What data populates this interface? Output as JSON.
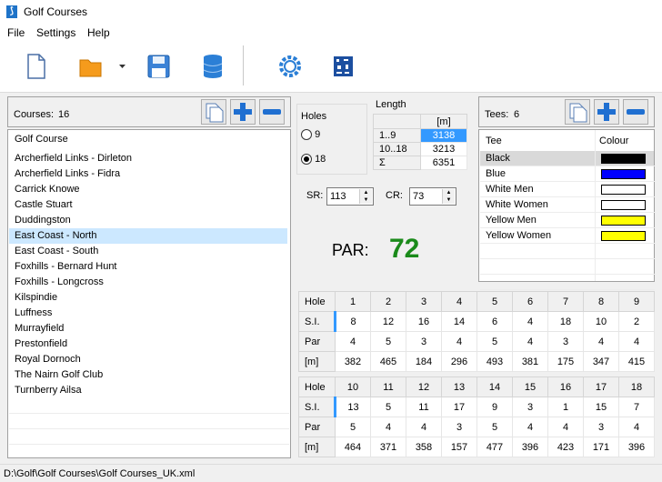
{
  "window": {
    "title": "Golf Courses"
  },
  "menu": [
    "File",
    "Settings",
    "Help"
  ],
  "courses": {
    "label": "Courses:",
    "count": "16",
    "header": "Golf Course",
    "items": [
      "Archerfield Links - Dirleton",
      "Archerfield Links - Fidra",
      "Carrick Knowe",
      "Castle Stuart",
      "Duddingston",
      "East Coast - North",
      "East Coast - South",
      "Foxhills - Bernard Hunt",
      "Foxhills - Longcross",
      "Kilspindie",
      "Luffness",
      "Murrayfield",
      "Prestonfield",
      "Royal Dornoch",
      "The Nairn Golf Club",
      "Turnberry Ailsa"
    ],
    "selected_index": 5
  },
  "holes": {
    "label": "Holes",
    "option9": "9",
    "option18": "18",
    "selected": "18"
  },
  "length": {
    "label": "Length",
    "unit": "[m]",
    "rows": [
      {
        "label": "1..9",
        "value": "3138"
      },
      {
        "label": "10..18",
        "value": "3213"
      },
      {
        "label": "Σ",
        "value": "6351"
      }
    ]
  },
  "sr": {
    "label": "SR:",
    "value": "113"
  },
  "cr": {
    "label": "CR:",
    "value": "73"
  },
  "par": {
    "label": "PAR:",
    "value": "72"
  },
  "tees": {
    "label": "Tees:",
    "count": "6",
    "col_tee": "Tee",
    "col_colour": "Colour",
    "items": [
      {
        "name": "Black",
        "color": "#000000"
      },
      {
        "name": "Blue",
        "color": "#0000ff"
      },
      {
        "name": "White Men",
        "color": "#ffffff"
      },
      {
        "name": "White Women",
        "color": "#ffffff"
      },
      {
        "name": "Yellow Men",
        "color": "#ffff00"
      },
      {
        "name": "Yellow Women",
        "color": "#ffff00"
      }
    ]
  },
  "front9": {
    "row_labels": [
      "Hole",
      "S.I.",
      "Par",
      "[m]"
    ],
    "hole": [
      "1",
      "2",
      "3",
      "4",
      "5",
      "6",
      "7",
      "8",
      "9"
    ],
    "si": [
      "8",
      "12",
      "16",
      "14",
      "6",
      "4",
      "18",
      "10",
      "2"
    ],
    "par": [
      "4",
      "5",
      "3",
      "4",
      "5",
      "4",
      "3",
      "4",
      "4"
    ],
    "m": [
      "382",
      "465",
      "184",
      "296",
      "493",
      "381",
      "175",
      "347",
      "415"
    ]
  },
  "back9": {
    "row_labels": [
      "Hole",
      "S.I.",
      "Par",
      "[m]"
    ],
    "hole": [
      "10",
      "11",
      "12",
      "13",
      "14",
      "15",
      "16",
      "17",
      "18"
    ],
    "si": [
      "13",
      "5",
      "11",
      "17",
      "9",
      "3",
      "1",
      "15",
      "7"
    ],
    "par": [
      "5",
      "4",
      "4",
      "3",
      "5",
      "4",
      "4",
      "3",
      "4"
    ],
    "m": [
      "464",
      "371",
      "358",
      "157",
      "477",
      "396",
      "423",
      "171",
      "396"
    ]
  },
  "status": {
    "path": "D:\\Golf\\Golf Courses\\Golf Courses_UK.xml"
  },
  "icons": [
    "new-file-icon",
    "open-folder-icon",
    "dropdown-arrow-icon",
    "save-icon",
    "database-icon",
    "settings-gear-icon",
    "barcode-icon",
    "copy-icon",
    "add-icon",
    "remove-icon"
  ],
  "colors": {
    "accent": "#1e73c8",
    "par_value": "#1a8a1a",
    "selection": "#cce8ff"
  }
}
